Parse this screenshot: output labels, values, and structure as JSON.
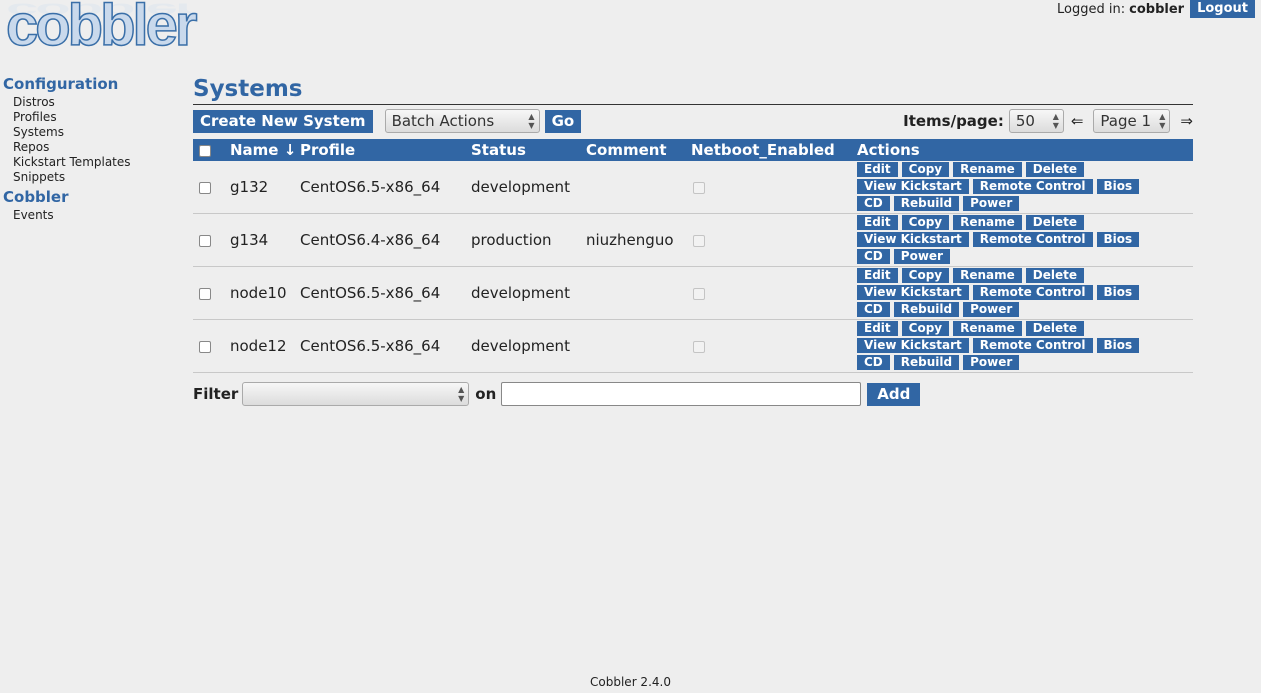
{
  "logo": {
    "text": "cobbler"
  },
  "header": {
    "logged_in_label": "Logged in:",
    "username": "cobbler",
    "logout_label": "Logout"
  },
  "sidebar": {
    "section1_title": "Configuration",
    "config_items": [
      "Distros",
      "Profiles",
      "Systems",
      "Repos",
      "Kickstart Templates",
      "Snippets"
    ],
    "section2_title": "Cobbler",
    "cobbler_items": [
      "Events"
    ]
  },
  "main": {
    "title": "Systems",
    "create_label": "Create New System",
    "batch_label": "Batch Actions",
    "go_label": "Go",
    "items_per_page_label": "Items/page:",
    "items_per_page_value": "50",
    "prev_arrow": "⇐",
    "page_label": "Page 1",
    "next_arrow": "⇒",
    "columns": [
      "Name ↓",
      "Profile",
      "Status",
      "Comment",
      "Netboot_Enabled",
      "Actions"
    ],
    "rows": [
      {
        "name": "g132",
        "profile": "CentOS6.5-x86_64",
        "status": "development",
        "comment": "",
        "actions": [
          "Edit",
          "Copy",
          "Rename",
          "Delete",
          "View Kickstart",
          "Remote Control",
          "Bios",
          "CD",
          "Rebuild",
          "Power"
        ]
      },
      {
        "name": "g134",
        "profile": "CentOS6.4-x86_64",
        "status": "production",
        "comment": "niuzhenguo",
        "actions": [
          "Edit",
          "Copy",
          "Rename",
          "Delete",
          "View Kickstart",
          "Remote Control",
          "Bios",
          "CD",
          "Power"
        ]
      },
      {
        "name": "node10",
        "profile": "CentOS6.5-x86_64",
        "status": "development",
        "comment": "",
        "actions": [
          "Edit",
          "Copy",
          "Rename",
          "Delete",
          "View Kickstart",
          "Remote Control",
          "Bios",
          "CD",
          "Rebuild",
          "Power"
        ]
      },
      {
        "name": "node12",
        "profile": "CentOS6.5-x86_64",
        "status": "development",
        "comment": "",
        "actions": [
          "Edit",
          "Copy",
          "Rename",
          "Delete",
          "View Kickstart",
          "Remote Control",
          "Bios",
          "CD",
          "Rebuild",
          "Power"
        ]
      }
    ],
    "filter_label": "Filter",
    "filter_select_value": "",
    "on_label": "on",
    "filter_text_value": "",
    "add_label": "Add"
  },
  "footer": {
    "version": "Cobbler 2.4.0"
  },
  "colors": {
    "accent": "#3166a4",
    "background": "#eeeeee"
  }
}
